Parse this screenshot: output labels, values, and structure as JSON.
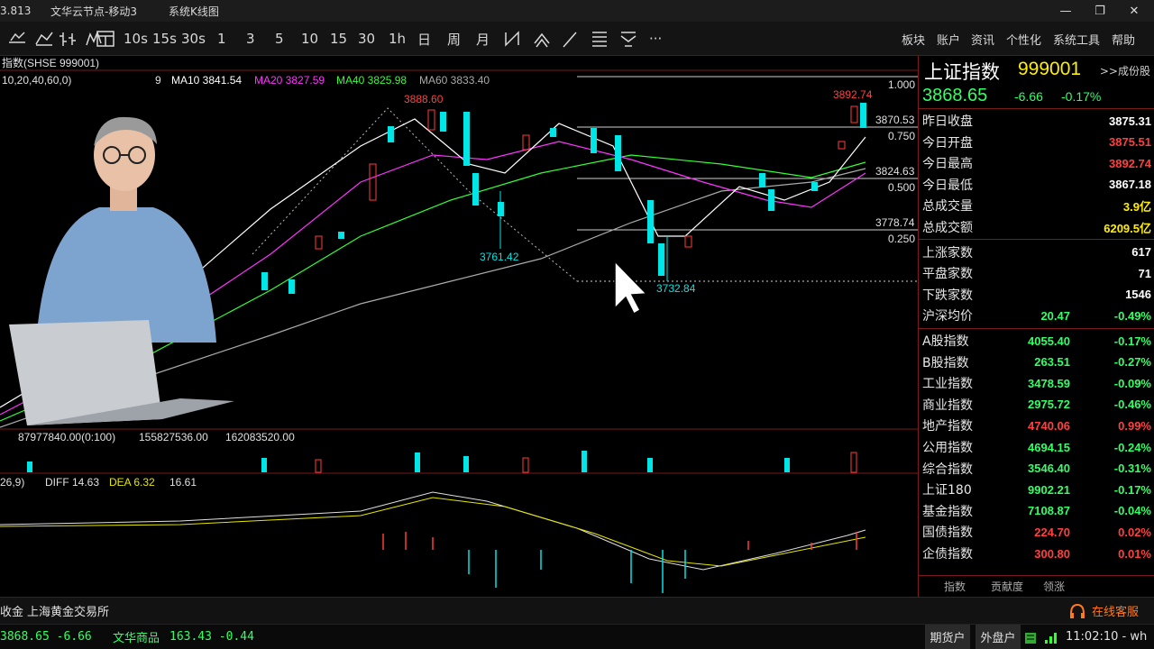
{
  "window": {
    "title_left": "3.813",
    "title_server": "文华云节点-移动3",
    "title_view": "系统K线图",
    "ctrl_min": "—",
    "ctrl_max": "❐",
    "ctrl_close": "✕"
  },
  "toolbar": {
    "periods": [
      "10s",
      "15s",
      "30s",
      "1",
      "3",
      "5",
      "10",
      "15",
      "30",
      "1h",
      "日",
      "周",
      "月"
    ],
    "menu": [
      "板块",
      "账户",
      "资讯",
      "个性化",
      "系统工具",
      "帮助"
    ],
    "more": "···"
  },
  "chart": {
    "symbol_label": "指数(SHSE  999001)",
    "ma_params": "10,20,40,60,0)",
    "ma_small": "9",
    "ma10": "MA10 3841.54",
    "ma20": "MA20 3827.59",
    "ma40": "MA40 3825.98",
    "ma60": "MA60 3833.40",
    "high_label": "3888.60",
    "low1_label": "3761.42",
    "low2_label": "3732.84",
    "last_high_label": "3892.74",
    "fib": [
      {
        "ratio": "1.000",
        "price": ""
      },
      {
        "ratio": "0.750",
        "price": "3870.53"
      },
      {
        "ratio": "0.500",
        "price": "3824.63"
      },
      {
        "ratio": "0.250",
        "price": "3778.74"
      }
    ],
    "vol_header": "87977840.00(0:100)",
    "vol_v2": "155827536.00",
    "vol_v3": "162083520.00",
    "macd_header": "26,9)",
    "diff": "DIFF 14.63",
    "dea": "DEA 6.32",
    "macd_val": "16.61"
  },
  "colors": {
    "up": "#ff3b3b",
    "down": "#00e5e5",
    "ma10": "#ffffff",
    "ma20": "#ff33ff",
    "ma40": "#33ff33",
    "ma60": "#aaaaaa",
    "label_red": "#ff4040",
    "label_green": "#33ff66"
  },
  "quote": {
    "name": "上证指数",
    "code": "999001",
    "constituents": ">>成份股",
    "price": "3868.65",
    "change": "-6.66",
    "pct": "-0.17%",
    "rows": [
      {
        "label": "昨日收盘",
        "value": "3875.31",
        "color": "#ffffff"
      },
      {
        "label": "今日开盘",
        "value": "3875.51",
        "color": "#ff4040"
      },
      {
        "label": "今日最高",
        "value": "3892.74",
        "color": "#ff4040"
      },
      {
        "label": "今日最低",
        "value": "3867.18",
        "color": "#ffffff"
      },
      {
        "label": "总成交量",
        "value": "3.9亿",
        "color": "#ffee00"
      },
      {
        "label": "总成交额",
        "value": "6209.5亿",
        "color": "#ffee00"
      }
    ],
    "breadth": [
      {
        "label": "上涨家数",
        "value": "617"
      },
      {
        "label": "平盘家数",
        "value": "71"
      },
      {
        "label": "下跌家数",
        "value": "1546"
      }
    ],
    "hs_avg": {
      "label": "沪深均价",
      "value": "20.47",
      "pct": "-0.49%"
    },
    "indices": [
      {
        "label": "A股指数",
        "value": "4055.40",
        "pct": "-0.17%",
        "up": false
      },
      {
        "label": "B股指数",
        "value": "263.51",
        "pct": "-0.27%",
        "up": false
      },
      {
        "label": "工业指数",
        "value": "3478.59",
        "pct": "-0.09%",
        "up": false
      },
      {
        "label": "商业指数",
        "value": "2975.72",
        "pct": "-0.46%",
        "up": false
      },
      {
        "label": "地产指数",
        "value": "4740.06",
        "pct": "0.99%",
        "up": true
      },
      {
        "label": "公用指数",
        "value": "4694.15",
        "pct": "-0.24%",
        "up": false
      },
      {
        "label": "综合指数",
        "value": "3546.40",
        "pct": "-0.31%",
        "up": false
      },
      {
        "label": "上证180",
        "value": "9902.21",
        "pct": "-0.17%",
        "up": false
      },
      {
        "label": "基金指数",
        "value": "7108.87",
        "pct": "-0.04%",
        "up": false
      },
      {
        "label": "国债指数",
        "value": "224.70",
        "pct": "0.02%",
        "up": true
      },
      {
        "label": "企债指数",
        "value": "300.80",
        "pct": "0.01%",
        "up": true
      }
    ],
    "tabs": [
      "指数",
      "贡献度",
      "领涨"
    ]
  },
  "statusbar": {
    "left": "收金",
    "exchange": "上海黄金交易所",
    "service": "在线客服"
  },
  "bottombar": {
    "ticker1": "3868.65  -6.66",
    "ticker2_name": "文华商品",
    "ticker2_vals": "163.43  -0.44",
    "btn_futures": "期货户",
    "btn_outer": "外盘户",
    "clock": "11:02:10 - wh"
  }
}
